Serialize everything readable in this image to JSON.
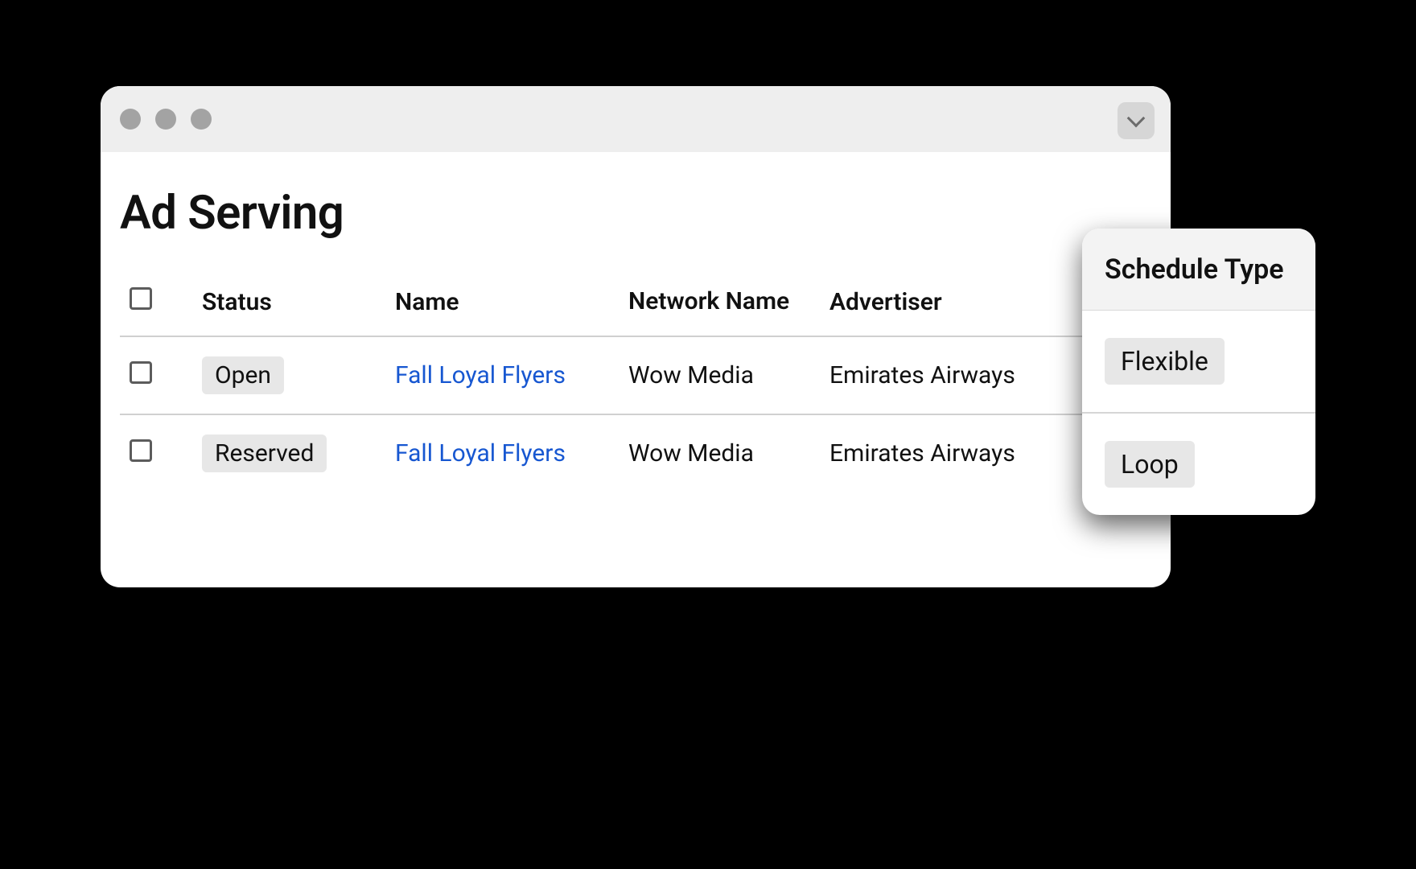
{
  "page": {
    "title": "Ad Serving"
  },
  "columns": {
    "status": "Status",
    "name": "Name",
    "network": "Network Name",
    "advertiser": "Advertiser"
  },
  "rows": [
    {
      "status": "Open",
      "name": "Fall Loyal Flyers",
      "network": "Wow Media",
      "advertiser": "Emirates Airways"
    },
    {
      "status": "Reserved",
      "name": "Fall Loyal Flyers",
      "network": "Wow Media",
      "advertiser": "Emirates Airways"
    }
  ],
  "panel": {
    "title": "Schedule Type",
    "options": [
      "Flexible",
      "Loop"
    ]
  }
}
